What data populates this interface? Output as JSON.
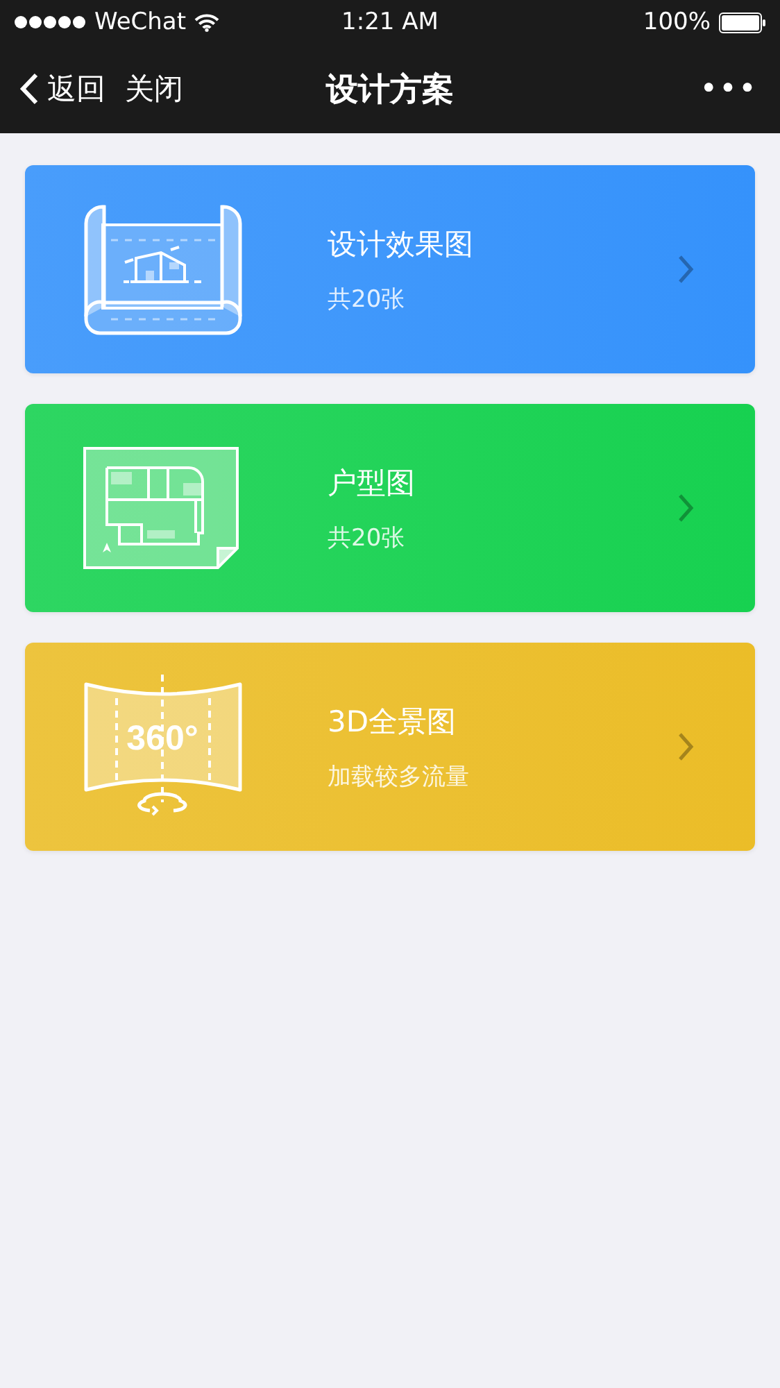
{
  "status_bar": {
    "carrier": "WeChat",
    "time": "1:21 AM",
    "battery": "100%"
  },
  "nav": {
    "back": "返回",
    "close": "关闭",
    "title": "设计方案",
    "more": "•••"
  },
  "cards": [
    {
      "kind": "blueprint",
      "title": "设计效果图",
      "subtitle": "共20张",
      "color": "#3592fb"
    },
    {
      "kind": "floorplan",
      "title": "户型图",
      "subtitle": "共20张",
      "color": "#17d150"
    },
    {
      "kind": "panorama",
      "title": "3D全景图",
      "subtitle": "加载较多流量",
      "color": "#ebbd28",
      "icon_text": "360°"
    }
  ]
}
